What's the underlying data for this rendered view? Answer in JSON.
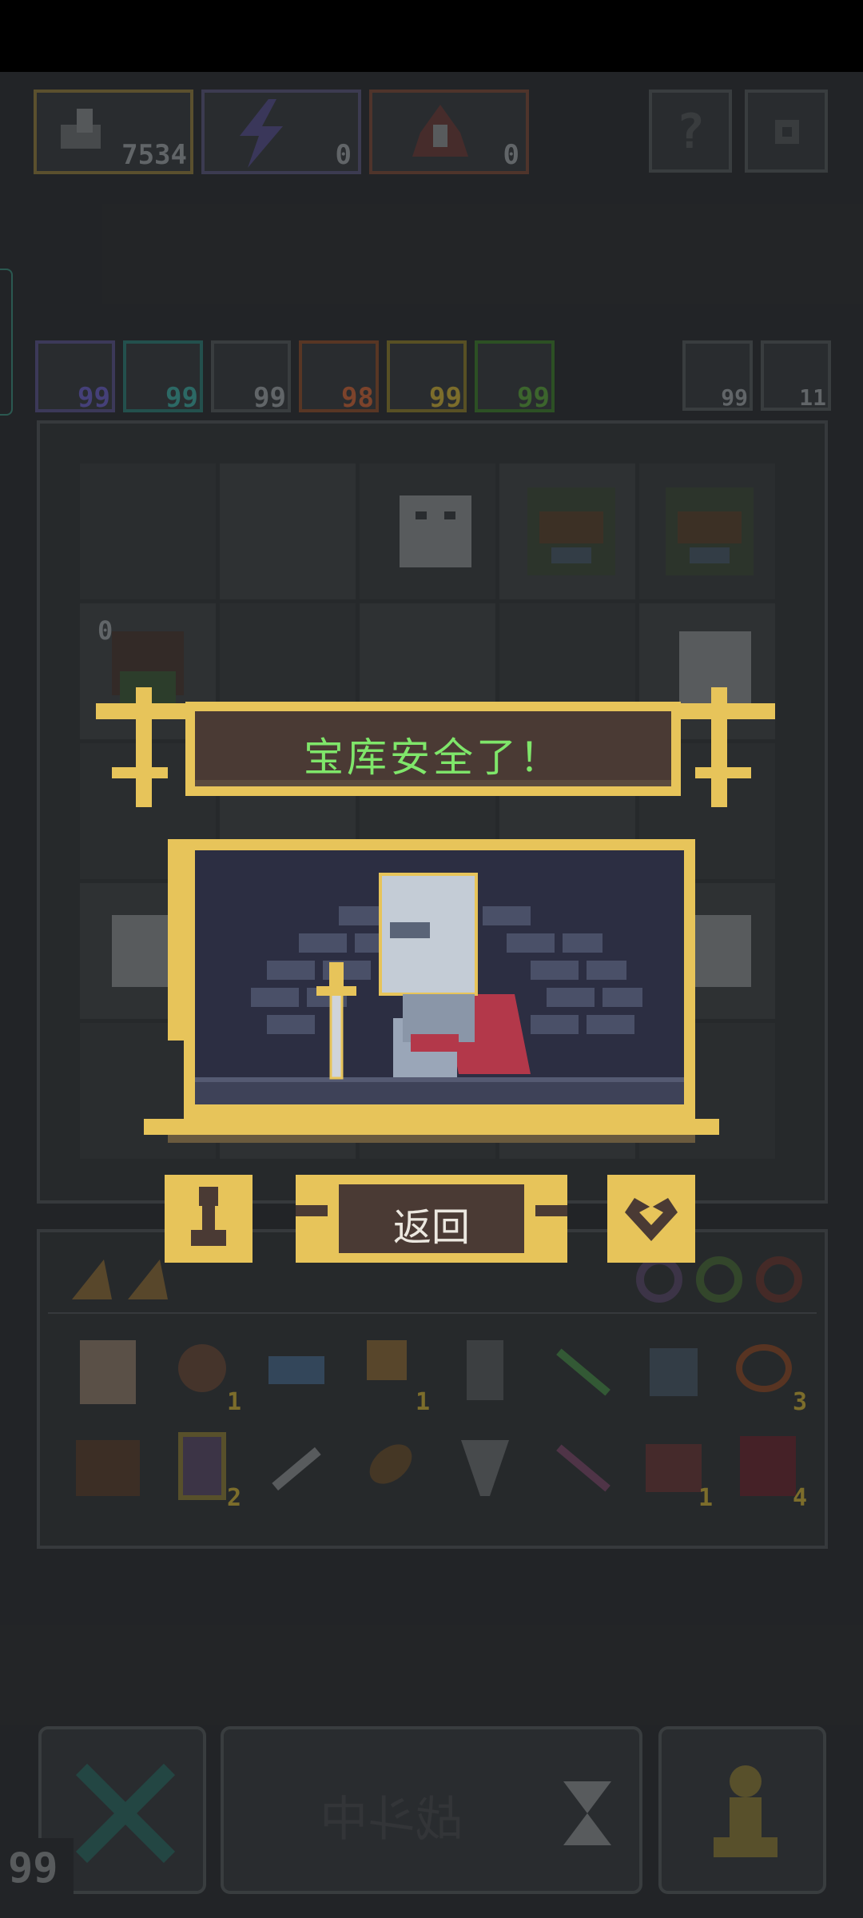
{
  "resources": [
    {
      "name": "coin-counter",
      "icon": "hand-coin-icon",
      "value": "7534",
      "color": "#c9a24a"
    },
    {
      "name": "energy-counter",
      "icon": "lightning-icon",
      "value": "0",
      "color": "#7a73c9"
    },
    {
      "name": "gem-counter",
      "icon": "crown-gem-icon",
      "value": "0",
      "color": "#c9623e"
    }
  ],
  "top_buttons": [
    {
      "name": "help-button",
      "icon": "question-icon"
    },
    {
      "name": "settings-button",
      "icon": "gear-icon"
    }
  ],
  "stats": [
    {
      "icon": "lightning-icon",
      "value": "99",
      "color": "#7a6bd1"
    },
    {
      "icon": "spiral-icon",
      "value": "99",
      "color": "#3fb0a8"
    },
    {
      "icon": "wings-icon",
      "value": "99",
      "color": "#8a8d90"
    },
    {
      "icon": "fire-icon",
      "value": "98",
      "color": "#d0743a"
    },
    {
      "icon": "arrow-up-icon",
      "value": "99",
      "color": "#d8b83a"
    },
    {
      "icon": "leaf-icon",
      "value": "99",
      "color": "#5fae3f"
    }
  ],
  "side_stats": [
    {
      "icon": "door-icon",
      "value": "99"
    },
    {
      "icon": "key-icon",
      "value": "11"
    }
  ],
  "grid_label": "0",
  "dialog": {
    "title": "宝库安全了！",
    "return_label": "返回",
    "left_icon": "chess-pawn-icon",
    "right_icon": "heart-gem-icon",
    "colors": {
      "gold": "#e7c45a",
      "title_text": "#7fe66a",
      "panel": "#4a3a34"
    }
  },
  "inventory": {
    "row1": [
      {
        "icon": "map-icon",
        "count": ""
      },
      {
        "icon": "eye-orb-icon",
        "count": "1"
      },
      {
        "icon": "goggles-icon",
        "count": ""
      },
      {
        "icon": "axe-icon",
        "count": "1"
      },
      {
        "icon": "device-icon",
        "count": ""
      },
      {
        "icon": "green-arrow-icon",
        "count": ""
      },
      {
        "icon": "bell-icon",
        "count": ""
      },
      {
        "icon": "ring-icon",
        "count": "3"
      }
    ],
    "row2": [
      {
        "icon": "mask-icon",
        "count": ""
      },
      {
        "icon": "potion-jar-icon",
        "count": "2"
      },
      {
        "icon": "dagger-icon",
        "count": ""
      },
      {
        "icon": "leaf-blade-icon",
        "count": ""
      },
      {
        "icon": "tornado-icon",
        "count": ""
      },
      {
        "icon": "purple-arrow-icon",
        "count": ""
      },
      {
        "icon": "crown-icon",
        "count": "1"
      },
      {
        "icon": "red-helmet-icon",
        "count": "4"
      }
    ]
  },
  "bottom": {
    "action_label": "战斗中",
    "counter": "99",
    "left_icon": "cross-swords-icon",
    "hourglass_icon": "hourglass-icon",
    "right_icon": "chess-pawn-icon"
  }
}
